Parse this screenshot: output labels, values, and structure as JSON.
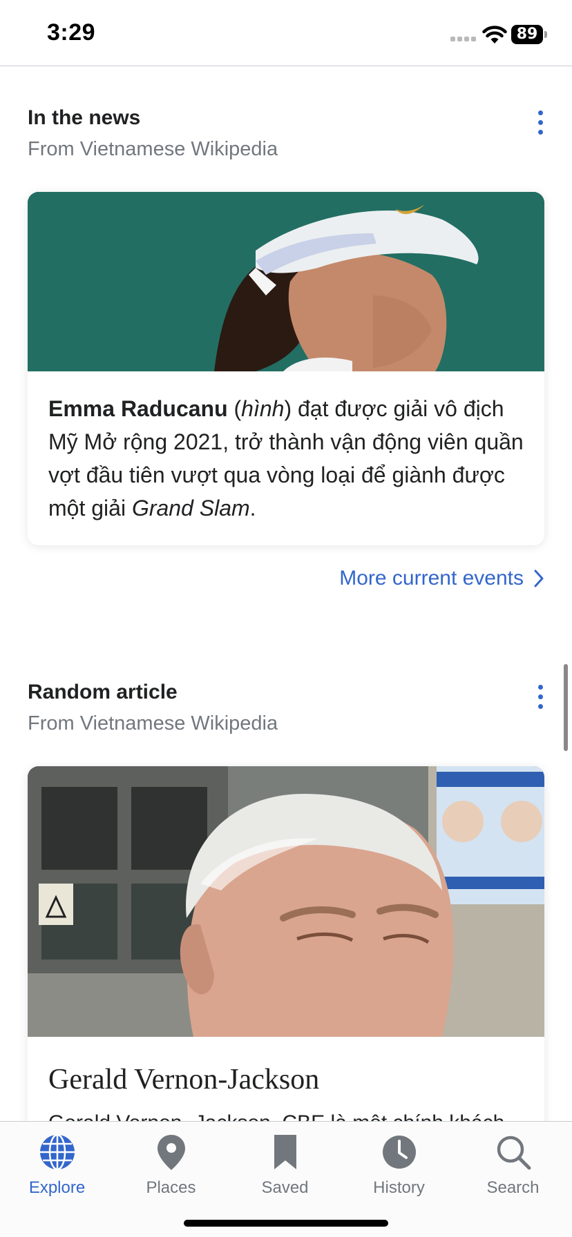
{
  "status_bar": {
    "time": "3:29",
    "battery": "89"
  },
  "news": {
    "title": "In the news",
    "subtitle": "From Vietnamese Wikipedia",
    "story": {
      "name": "Emma Raducanu",
      "open_paren": " (",
      "image_ref": "hình",
      "body": ") đạt được giải vô địch Mỹ Mở rộng 2021, trở thành vận động viên quần vợt đầu tiên vượt qua vòng loại để giành được một giải ",
      "event": "Grand Slam",
      "end": "."
    },
    "more_link": "More current events"
  },
  "random": {
    "title": "Random article",
    "subtitle": "From Vietnamese Wikipedia",
    "article_title": "Gerald Vernon-Jackson",
    "excerpt": "Gerald Vernon- Jackson, CBE là một chính khách"
  },
  "tabs": [
    {
      "label": "Explore",
      "icon": "globe-icon",
      "active": true
    },
    {
      "label": "Places",
      "icon": "map-pin-icon",
      "active": false
    },
    {
      "label": "Saved",
      "icon": "bookmark-icon",
      "active": false
    },
    {
      "label": "History",
      "icon": "clock-icon",
      "active": false
    },
    {
      "label": "Search",
      "icon": "search-icon",
      "active": false
    }
  ],
  "colors": {
    "accent": "#3366cc",
    "inactive": "#72777d",
    "text": "#202122"
  }
}
